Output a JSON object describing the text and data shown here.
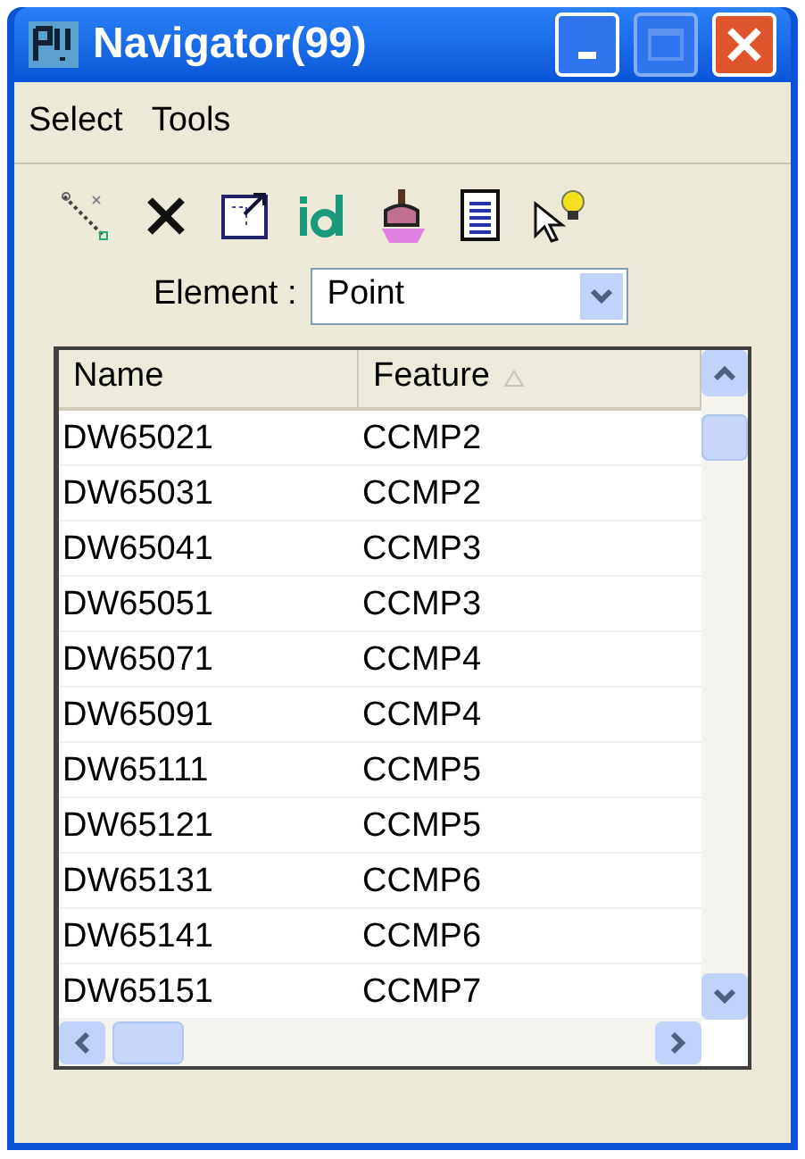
{
  "window": {
    "title": "Navigator(99)"
  },
  "menu": [
    "Select",
    "Tools"
  ],
  "element_field": {
    "label": "Element :",
    "value": "Point"
  },
  "table": {
    "columns": [
      {
        "label": "Name",
        "sorted": false
      },
      {
        "label": "Feature",
        "sorted": true
      }
    ],
    "rows": [
      [
        "DW65021",
        "CCMP2"
      ],
      [
        "DW65031",
        "CCMP2"
      ],
      [
        "DW65041",
        "CCMP3"
      ],
      [
        "DW65051",
        "CCMP3"
      ],
      [
        "DW65071",
        "CCMP4"
      ],
      [
        "DW65091",
        "CCMP4"
      ],
      [
        "DW65111",
        "CCMP5"
      ],
      [
        "DW65121",
        "CCMP5"
      ],
      [
        "DW65131",
        "CCMP6"
      ],
      [
        "DW65141",
        "CCMP6"
      ],
      [
        "DW65151",
        "CCMP7"
      ]
    ]
  }
}
